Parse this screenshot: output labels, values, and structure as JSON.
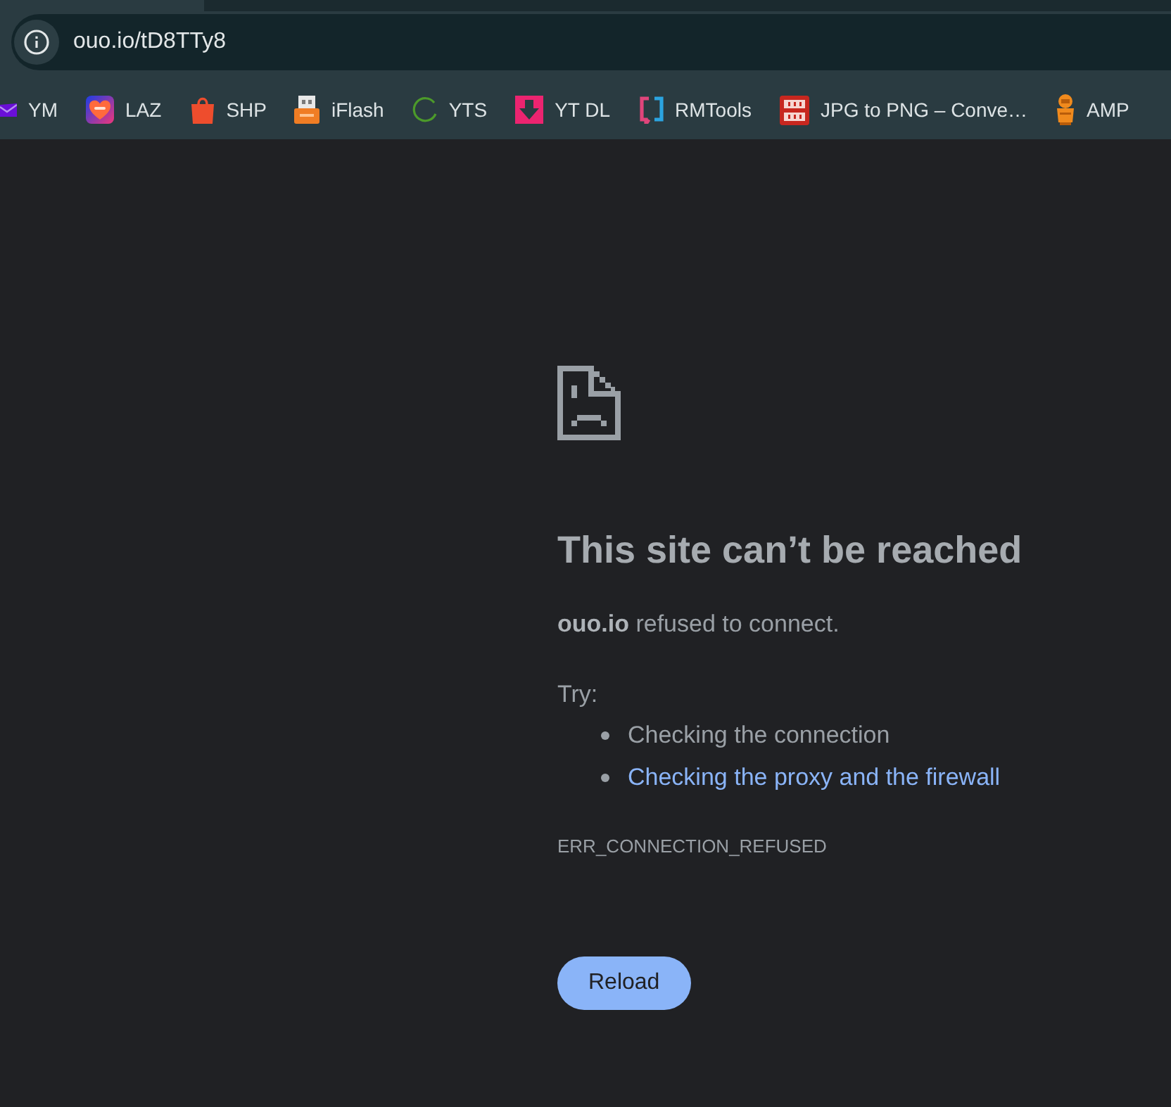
{
  "address_bar": {
    "url": "ouo.io/tD8TTy8"
  },
  "bookmarks": [
    {
      "label": "YM"
    },
    {
      "label": "LAZ"
    },
    {
      "label": "SHP"
    },
    {
      "label": "iFlash"
    },
    {
      "label": "YTS"
    },
    {
      "label": "YT DL"
    },
    {
      "label": "RMTools"
    },
    {
      "label": "JPG to PNG – Conve…"
    },
    {
      "label": "AMP"
    }
  ],
  "error_page": {
    "title": "This site can’t be reached",
    "message": "**ouo.io** refused to connect.",
    "try_label": "Try:",
    "suggestions": [
      {
        "kind": "text",
        "text": "Checking the connection"
      },
      {
        "kind": "link",
        "text": "Checking the proxy and the firewall"
      }
    ],
    "error_code": "ERR_CONNECTION_REFUSED",
    "reload_button": "Reload"
  }
}
